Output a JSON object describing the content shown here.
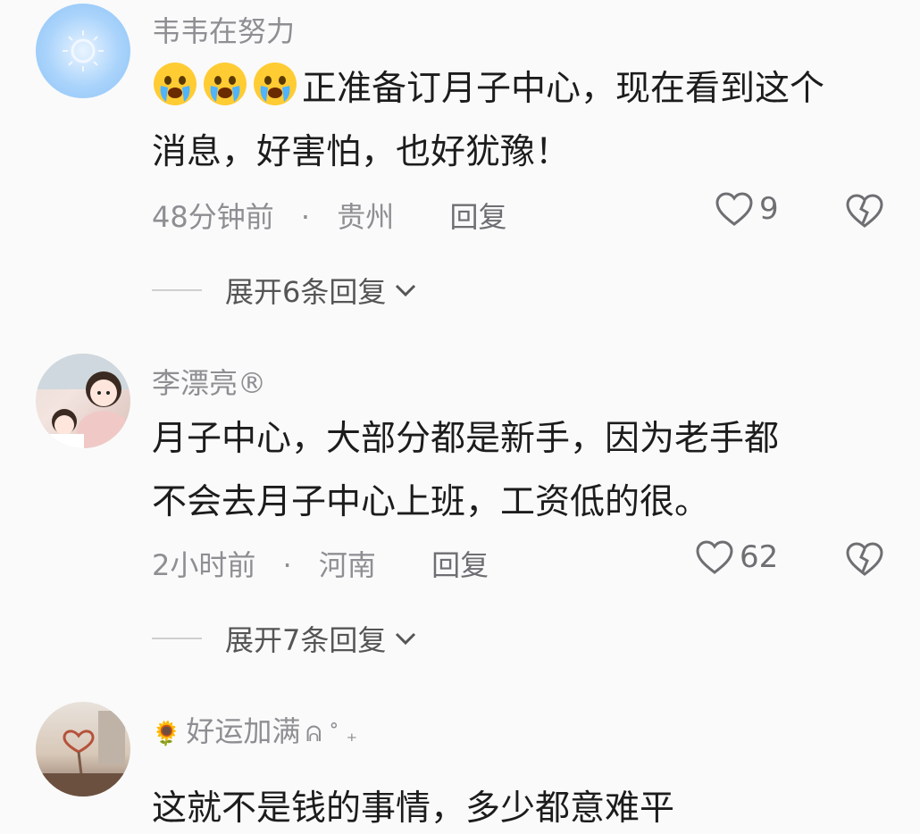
{
  "comments": [
    {
      "username": "韦韦在努力",
      "emoji_name": "crying-face-emoji",
      "line1": "正准备订月子中心，现在看到这个",
      "line2": "消息，好害怕，也好犹豫！",
      "time": "48分钟前",
      "sep": "·",
      "location": "贵州",
      "reply": "回复",
      "likes": "9",
      "expand": "展开6条回复"
    },
    {
      "username": "李漂亮®",
      "line1": "月子中心，大部分都是新手，因为老手都",
      "line2": "不会去月子中心上班，工资低的很。",
      "time": "2小时前",
      "sep": "·",
      "location": "河南",
      "reply": "回复",
      "likes": "62",
      "expand": "展开7条回复"
    },
    {
      "username_prefix": "🌻",
      "username": "好运加满",
      "username_suffix": "ᕱ ˚ ₊",
      "line1": "这就不是钱的事情，多少都意难平"
    }
  ],
  "colors": {
    "meta": "#8e8e93",
    "text": "#1c1c1c",
    "background": "#fafafa"
  }
}
